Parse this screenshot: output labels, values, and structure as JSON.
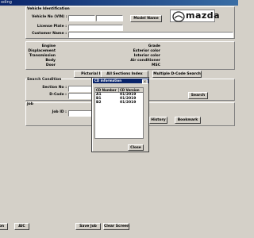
{
  "window": {
    "title": "oding"
  },
  "vehicle": {
    "section_title": "Vehicle Identification",
    "vin_label": "Vehicle No (VIN) :",
    "license_label": "License Plate :",
    "customer_label": "Customer Name :",
    "model_button": "Model Name",
    "brand": "mazda"
  },
  "specs": {
    "left": [
      "Engine",
      "Displacement",
      "Transmission",
      "Body",
      "Door"
    ],
    "right": [
      "Grade",
      "Exterior color",
      "Interior color",
      "Air conditioner",
      "MSC"
    ]
  },
  "actions": {
    "pictorial": "Pictorial Index",
    "all_sections": "All Sections Index",
    "multiple_dcode": "Multiple D-Code Search"
  },
  "search": {
    "section_title": "Search Condition",
    "section_label": "Section No :",
    "dcode_label": "D-Code :",
    "search_button": "Search"
  },
  "job": {
    "section_title": "Job",
    "job_id_label": "Job ID :",
    "history_button": "History",
    "bookmark_button": "Bookmark"
  },
  "dialog": {
    "title": "CD information",
    "close_glyph": "x",
    "columns": [
      "CD Number",
      "CD Version"
    ],
    "rows": [
      {
        "number": "A1",
        "version": "01/2019"
      },
      {
        "number": "B1",
        "version": "01/2019"
      },
      {
        "number": "B2",
        "version": "01/2019"
      }
    ],
    "close_button": "Close"
  },
  "footer": {
    "left_button_partial": "on",
    "aic_button": "AIC",
    "save_job": "Save Job",
    "clear_screen": "Clear Screen"
  }
}
